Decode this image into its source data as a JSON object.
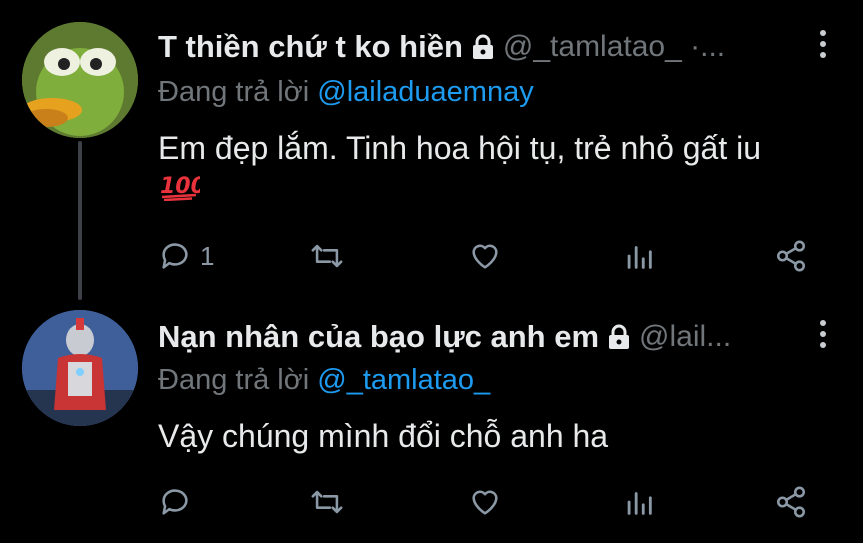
{
  "tweets": [
    {
      "display_name": "T thiền chứ t ko hiền",
      "handle": "@_tamlatao_ ·...",
      "reply_prefix": "Đang trả lời",
      "reply_to": "@lailaduaemnay",
      "text": "Em đẹp lắm. Tinh hoa hội tụ, trẻ nhỏ gất iu",
      "emoji": "hundred-points-icon",
      "reply_count": "1",
      "avatar_icon": "frog-avatar"
    },
    {
      "display_name": "Nạn nhân của bạo lực anh em",
      "handle": "@lail...",
      "reply_prefix": "Đang trả lời",
      "reply_to": "@_tamlatao_",
      "text": "Vậy chúng mình đổi chỗ anh ha",
      "reply_count": "",
      "avatar_icon": "hero-figure-avatar"
    }
  ],
  "colors": {
    "background": "#000000",
    "secondary_text": "#71767b",
    "mention": "#1d9bf0",
    "icon": "#8b98a5"
  }
}
